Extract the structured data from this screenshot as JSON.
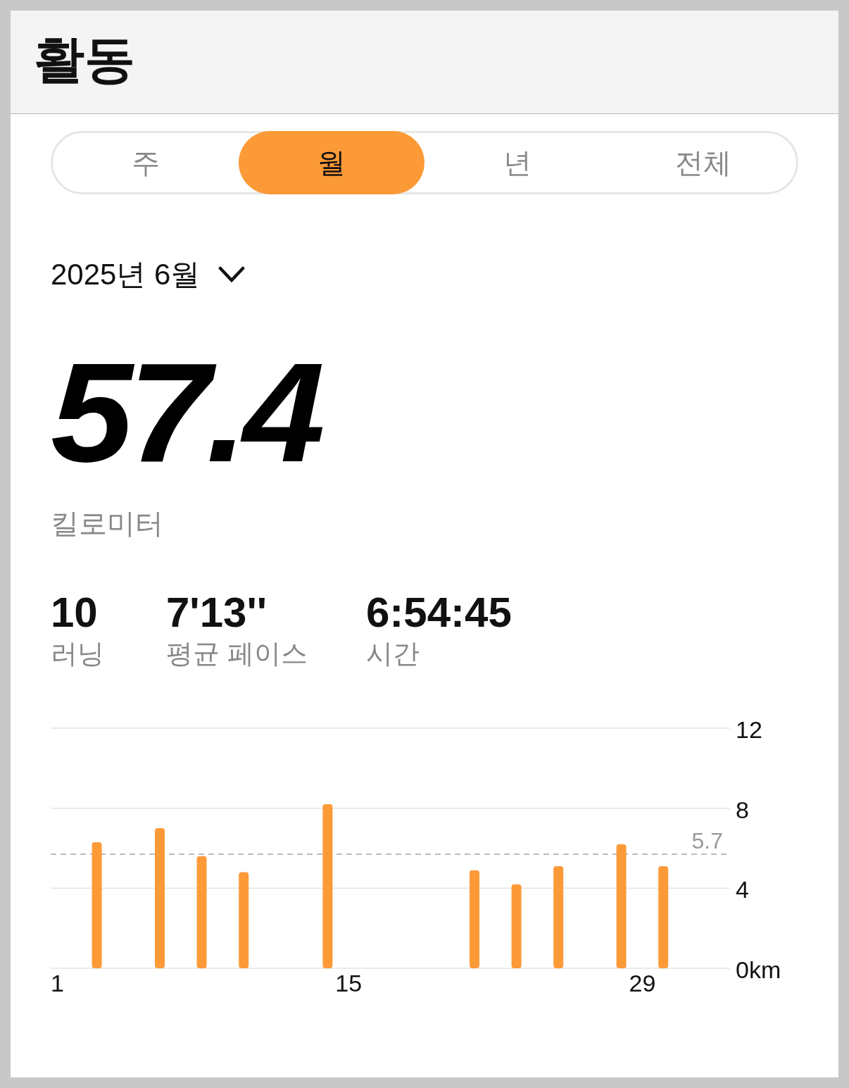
{
  "header": {
    "title": "활동"
  },
  "tabs": [
    {
      "label": "주",
      "selected": false
    },
    {
      "label": "월",
      "selected": true
    },
    {
      "label": "년",
      "selected": false
    },
    {
      "label": "전체",
      "selected": false
    }
  ],
  "period": {
    "label": "2025년 6월"
  },
  "total": {
    "value": "57.4",
    "unit": "킬로미터"
  },
  "stats": [
    {
      "value": "10",
      "label": "러닝"
    },
    {
      "value": "7'13''",
      "label": "평균 페이스"
    },
    {
      "value": "6:54:45",
      "label": "시간"
    }
  ],
  "chart": {
    "chart_data": {
      "type": "bar",
      "x": [
        3,
        6,
        8,
        10,
        14,
        21,
        23,
        25,
        28,
        30
      ],
      "series": [
        {
          "color": "#fd9a38",
          "values": [
            6.3,
            7.0,
            5.6,
            4.8,
            8.2,
            4.9,
            4.2,
            5.1,
            6.2,
            5.1
          ]
        }
      ],
      "xlim": [
        1,
        30
      ],
      "ylim": [
        0,
        12
      ],
      "yticks": [
        {
          "value": 0,
          "label": "0km"
        },
        4,
        8,
        12
      ],
      "xticks": [
        1,
        15,
        29
      ],
      "ref_lines": [
        {
          "axis": "y",
          "value": 5.7,
          "label": "5.7"
        }
      ]
    }
  }
}
